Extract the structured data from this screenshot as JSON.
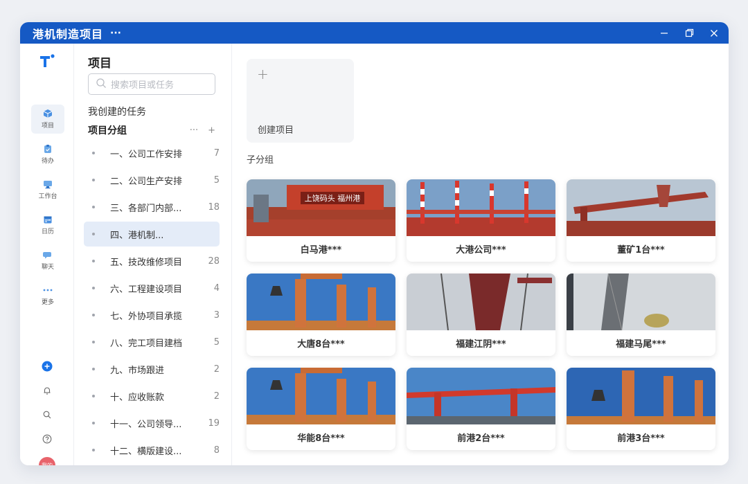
{
  "window": {
    "title": "港机制造项目",
    "more": "···"
  },
  "rail": {
    "items": [
      {
        "label": "项目",
        "icon": "cube-icon"
      },
      {
        "label": "待办",
        "icon": "todo-icon"
      },
      {
        "label": "工作台",
        "icon": "workbench-icon"
      },
      {
        "label": "日历",
        "icon": "calendar-icon"
      },
      {
        "label": "聊天",
        "icon": "chat-icon"
      },
      {
        "label": "更多",
        "icon": "more-icon"
      }
    ],
    "avatar": "我的"
  },
  "panel": {
    "title": "项目",
    "search_placeholder": "搜索项目或任务",
    "my_tasks": "我创建的任务",
    "group_title": "项目分组",
    "group_more": "···",
    "group_add": "+",
    "groups": [
      {
        "name": "一、公司工作安排",
        "count": "7"
      },
      {
        "name": "二、公司生产安排",
        "count": "5"
      },
      {
        "name": "三、各部门内部...",
        "count": "18"
      },
      {
        "name": "四、港机制...",
        "count": ""
      },
      {
        "name": "五、技改维修项目",
        "count": "28"
      },
      {
        "name": "六、工程建设项目",
        "count": "4"
      },
      {
        "name": "七、外协项目承揽",
        "count": "3"
      },
      {
        "name": "八、完工项目建档",
        "count": "5"
      },
      {
        "name": "九、市场跟进",
        "count": "2"
      },
      {
        "name": "十、应收账款",
        "count": "2"
      },
      {
        "name": "十一、公司领导...",
        "count": "19"
      },
      {
        "name": "十二、横版建设...",
        "count": "8"
      }
    ]
  },
  "main": {
    "create_plus": "+",
    "create_label": "创建项目",
    "subgroup_title": "子分组",
    "cards": [
      {
        "label": "白马港***",
        "image": "terminal-gate-photo",
        "sign": "上饶码头 福州港"
      },
      {
        "label": "大港公司***",
        "image": "red-white-cranes-photo"
      },
      {
        "label": "董矿1台***",
        "image": "ship-loader-photo"
      },
      {
        "label": "大唐8台***",
        "image": "grab-cranes-photo"
      },
      {
        "label": "福建江阴***",
        "image": "crane-lattice-photo"
      },
      {
        "label": "福建马尾***",
        "image": "crane-boom-photo"
      },
      {
        "label": "华能8台***",
        "image": "grab-cranes-photo"
      },
      {
        "label": "前港2台***",
        "image": "red-bridge-crane-photo"
      },
      {
        "label": "前港3台***",
        "image": "grab-cranes-photo"
      }
    ]
  },
  "colors": {
    "titlebar": "#1559c4",
    "accent": "#1a73e8",
    "active_bg": "#e4ecf8",
    "avatar": "#e8636b"
  }
}
